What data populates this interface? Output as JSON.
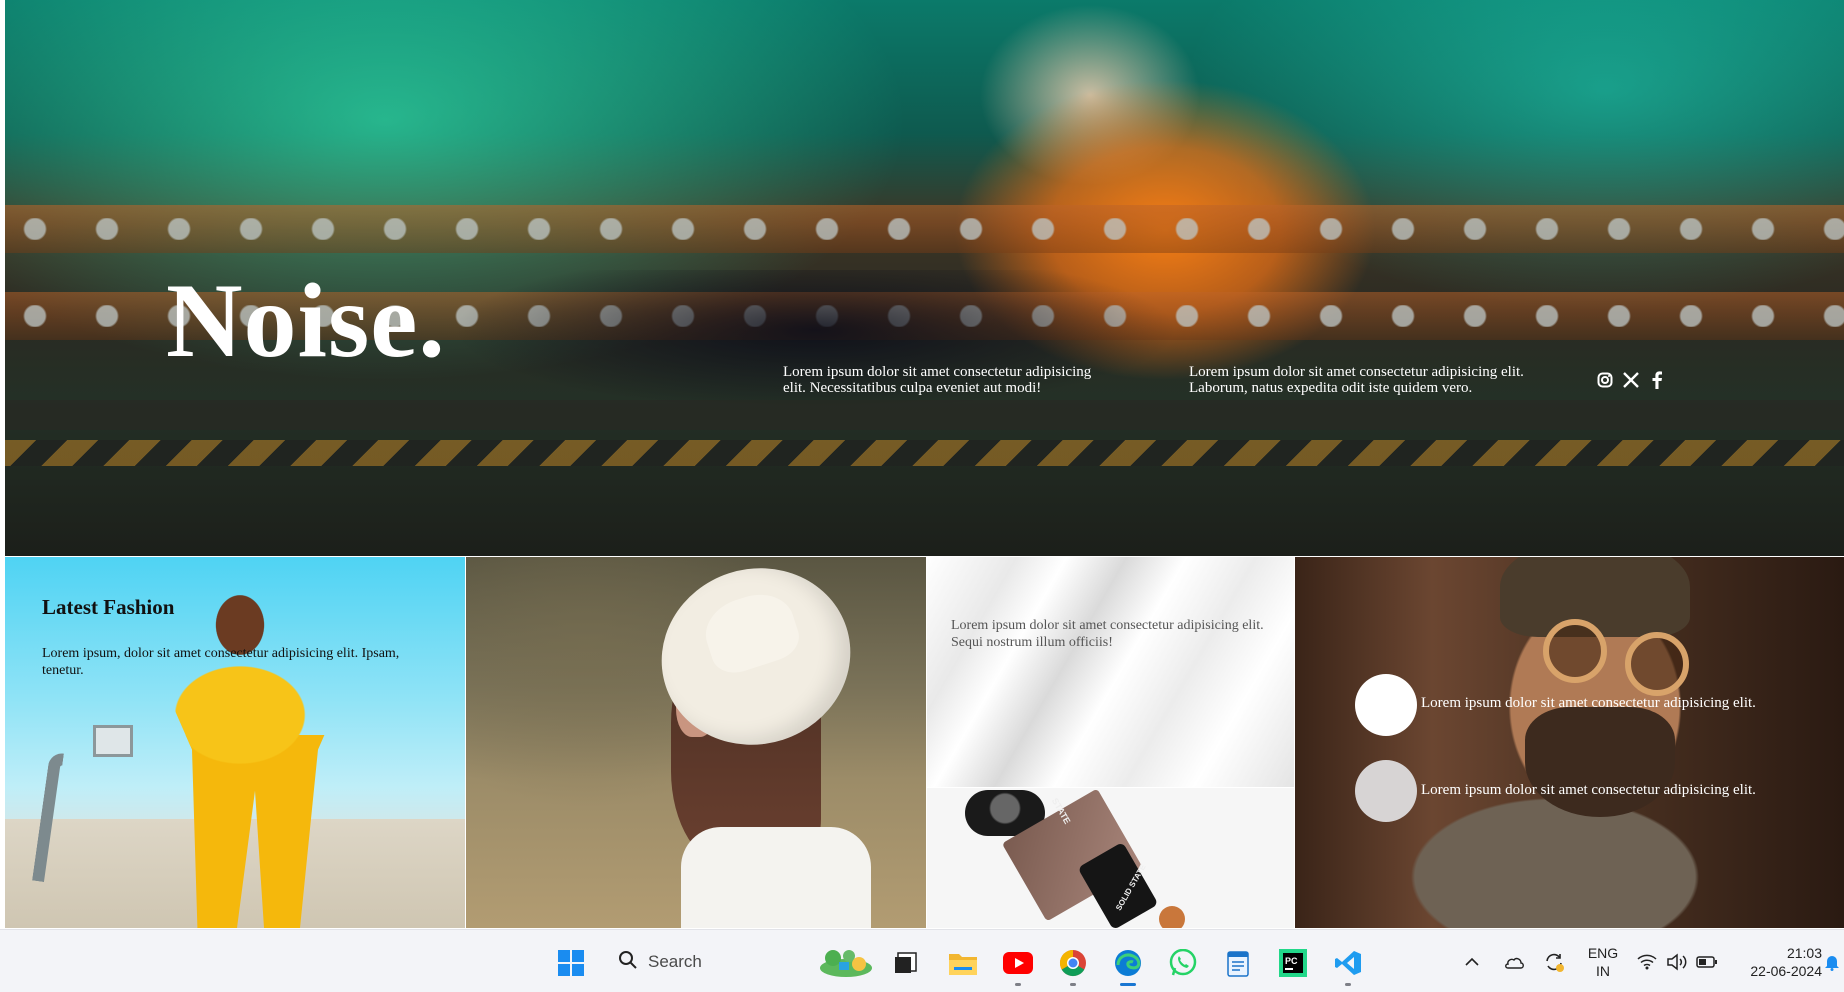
{
  "hero": {
    "brand": "Noise.",
    "text_1": "Lorem ipsum dolor sit amet consectetur adipisicing elit. Necessitatibus culpa eveniet aut modi!",
    "text_2": "Lorem ipsum dolor sit amet consectetur adipisicing elit. Laborum, natus expedita odit iste quidem vero.",
    "socials": [
      "instagram-icon",
      "x-icon",
      "facebook-icon"
    ]
  },
  "tiles": {
    "fashion": {
      "title": "Latest Fashion",
      "text": "Lorem ipsum, dolor sit amet consectetur adipisicing elit. Ipsam, tenetur."
    },
    "silk": {
      "text": "Lorem ipsum dolor sit amet consectetur adipisicing elit. Sequi nostrum illum officiis!"
    },
    "product": {
      "label_1": "STATE",
      "label_2": "SOLID STATE"
    },
    "man": {
      "text_1": "Lorem ipsum dolor sit amet consectetur adipisicing elit.",
      "text_2": "Lorem ipsum dolor sit amet consectetur adipisicing elit."
    }
  },
  "taskbar": {
    "search_placeholder": "Search",
    "apps": [
      "windows-start-icon",
      "search-icon",
      "widgets-icon",
      "task-view-icon",
      "file-explorer-icon",
      "youtube-icon",
      "chrome-icon",
      "edge-icon",
      "whatsapp-icon",
      "notepad-icon",
      "pycharm-icon",
      "vscode-icon"
    ],
    "tray": {
      "lang_1": "ENG",
      "lang_2": "IN",
      "time": "21:03",
      "date": "22-06-2024"
    }
  },
  "colors": {
    "taskbar_bg": "#f3f4f8",
    "accent": "#1976d2"
  }
}
